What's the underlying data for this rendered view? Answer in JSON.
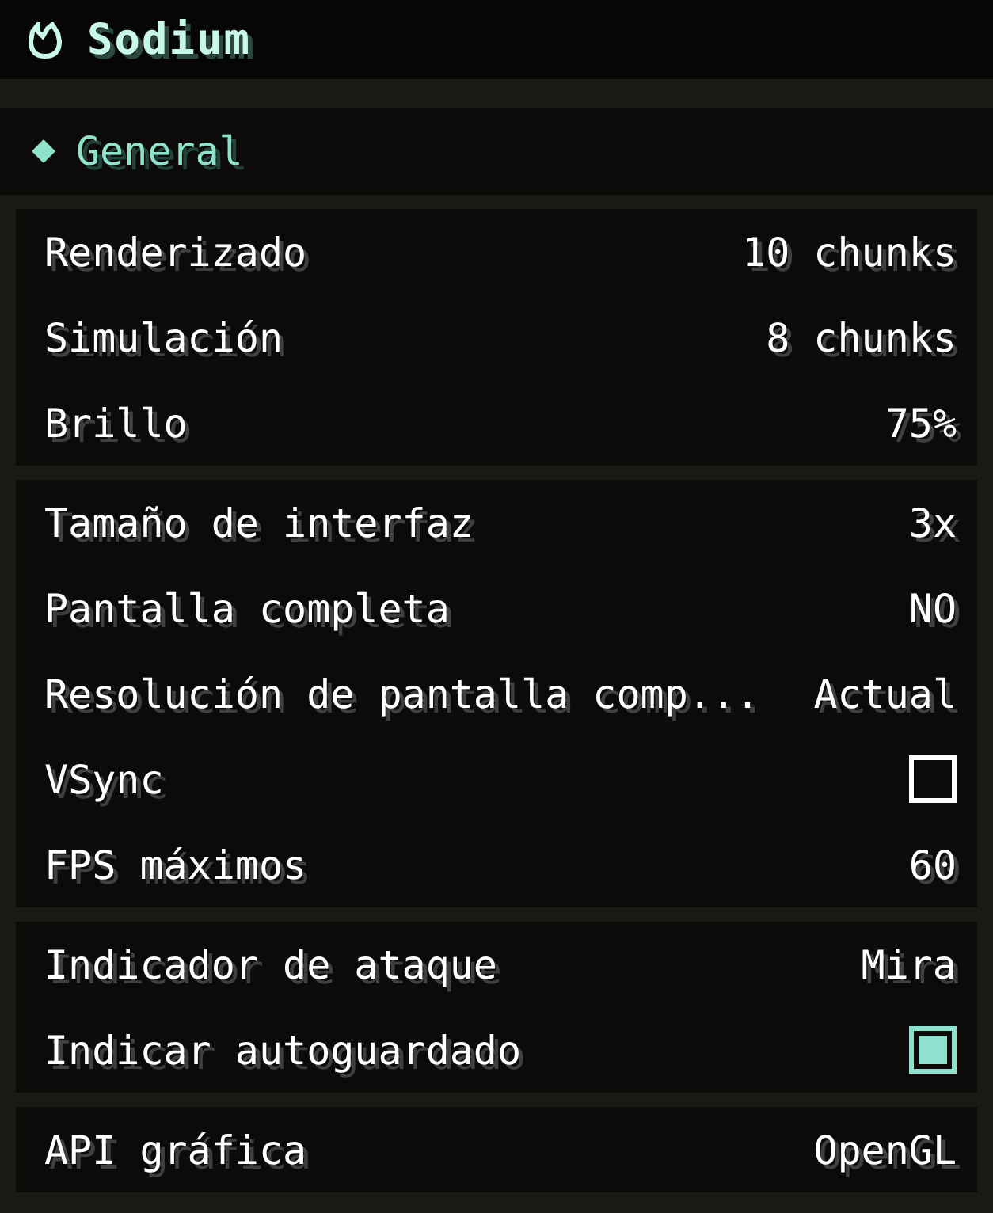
{
  "header": {
    "title": "Sodium"
  },
  "category": {
    "label": "General"
  },
  "groups": [
    {
      "options": [
        {
          "label": "Renderizado",
          "kind": "value",
          "value": "10 chunks"
        },
        {
          "label": "Simulación",
          "kind": "value",
          "value": "8 chunks"
        },
        {
          "label": "Brillo",
          "kind": "value",
          "value": "75%"
        }
      ]
    },
    {
      "options": [
        {
          "label": "Tamaño de interfaz",
          "kind": "value",
          "value": "3x"
        },
        {
          "label": "Pantalla completa",
          "kind": "value",
          "value": "NO"
        },
        {
          "label": "Resolución de pantalla comp...",
          "kind": "value",
          "value": "Actual"
        },
        {
          "label": "VSync",
          "kind": "checkbox",
          "checked": false
        },
        {
          "label": "FPS máximos",
          "kind": "value",
          "value": "60"
        }
      ]
    },
    {
      "options": [
        {
          "label": "Indicador de ataque",
          "kind": "value",
          "value": "Mira"
        },
        {
          "label": "Indicar autoguardado",
          "kind": "checkbox",
          "checked": true
        }
      ]
    },
    {
      "options": [
        {
          "label": "API gráfica",
          "kind": "value",
          "value": "OpenGL"
        }
      ]
    }
  ]
}
